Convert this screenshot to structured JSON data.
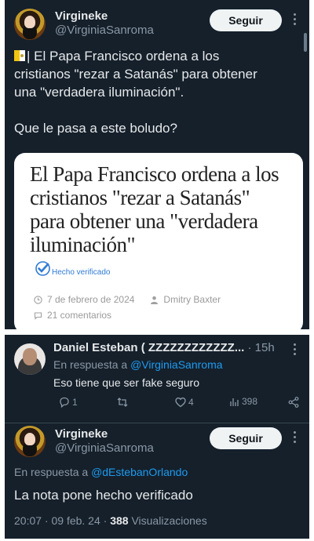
{
  "post": {
    "author_name": "Virgineke",
    "author_handle": "@VirginiaSanroma",
    "follow_label": "Seguir",
    "text_line1": "| El Papa Francisco ordena a los",
    "text_line2": "cristianos \"rezar a Satanás\" para obtener",
    "text_line3": "una \"verdadera iluminación\".",
    "text_line4": "Que le pasa a este boludo?",
    "card": {
      "headline_line1": "El Papa Francisco ordena a los",
      "headline_line2": "cristianos \"rezar a Satanás\"",
      "headline_line3": "para obtener una \"verdadera",
      "headline_line4": "iluminación\"",
      "verified_label": "Hecho verificado",
      "date": "7 de febrero de 2024",
      "author": "Dmitry Baxter",
      "comments": "21 comentarios"
    }
  },
  "reply1": {
    "author_name": "Daniel Esteban ( ZZZZZZZZZZZZ...",
    "dot": "·",
    "time": "15h",
    "in_reply_prefix": "En respuesta a",
    "in_reply_handle": "@VirginiaSanroma",
    "text": "Eso tiene que ser fake seguro",
    "replies": "1",
    "likes": "4",
    "views": "398"
  },
  "reply2": {
    "author_name": "Virgineke",
    "author_handle": "@VirginiaSanroma",
    "follow_label": "Seguir",
    "in_reply_prefix": "En respuesta a",
    "in_reply_handle": "@dEstebanOrlando",
    "text": "La nota pone hecho verificado",
    "timestamp": "20:07 · 09 feb. 24 ·",
    "views_count": "388",
    "views_label": "Visualizaciones"
  },
  "colors": {
    "background": "#15202b",
    "text": "#e7e9ea",
    "secondary": "#8b98a5",
    "link": "#1d9bf0"
  }
}
